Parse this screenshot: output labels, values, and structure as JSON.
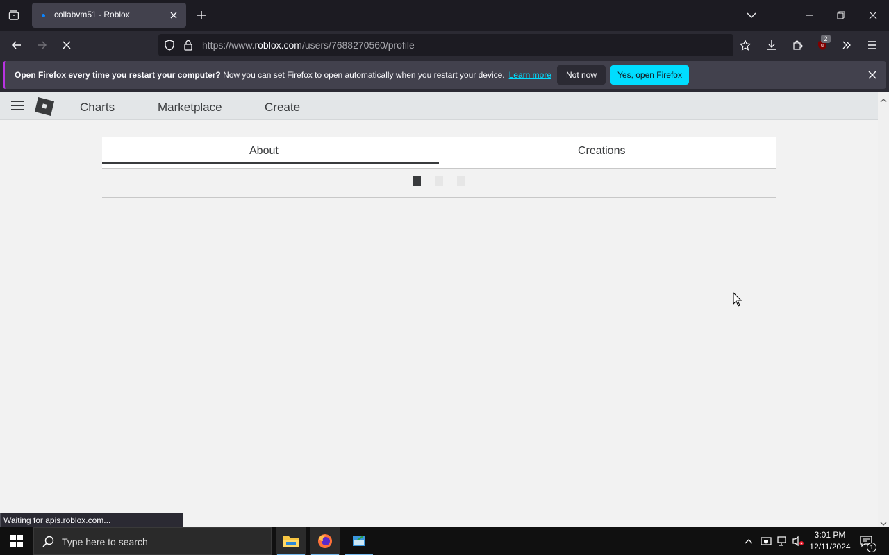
{
  "browser": {
    "tab": {
      "title": "collabvm51 - Roblox"
    },
    "url": {
      "prefix": "https://www.",
      "domain": "roblox.com",
      "path": "/users/7688270560/profile"
    },
    "extension_badge": "2",
    "notification": {
      "bold_text": "Open Firefox every time you restart your computer?",
      "text": " Now you can set Firefox to open automatically when you restart your device.",
      "learn_more": "Learn more",
      "not_now": "Not now",
      "yes_open": "Yes, open Firefox"
    },
    "status": "Waiting for apis.roblox.com..."
  },
  "roblox": {
    "nav": {
      "charts": "Charts",
      "marketplace": "Marketplace",
      "create": "Create"
    },
    "profile_tabs": {
      "about": "About",
      "creations": "Creations",
      "active": "About"
    }
  },
  "taskbar": {
    "search_placeholder": "Type here to search",
    "time": "3:01 PM",
    "date": "12/11/2024",
    "notification_count": "1"
  },
  "colors": {
    "accent_firefox": "#00ddff",
    "notif_border": "#b833e1",
    "roblox_text": "#393b3d"
  }
}
